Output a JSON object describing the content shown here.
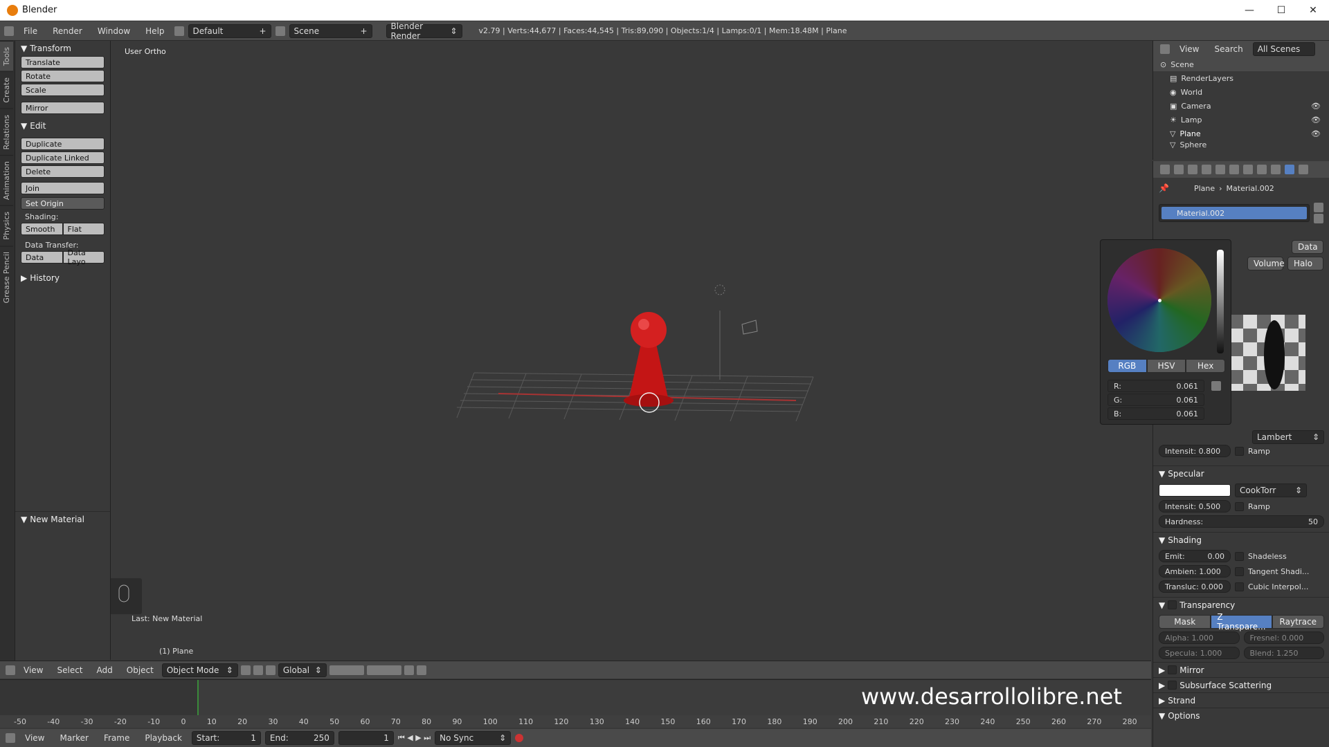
{
  "window": {
    "title": "Blender"
  },
  "infobar": {
    "menus": [
      "File",
      "Render",
      "Window",
      "Help"
    ],
    "layout": "Default",
    "scene": "Scene",
    "engine": "Blender Render",
    "stats": "v2.79 | Verts:44,677 | Faces:44,545 | Tris:89,090 | Objects:1/4 | Lamps:0/1 | Mem:18.48M | Plane"
  },
  "side_tabs": [
    "Tools",
    "Create",
    "Relations",
    "Animation",
    "Physics",
    "Grease Pencil"
  ],
  "toolshelf": {
    "transform_title": "Transform",
    "translate": "Translate",
    "rotate": "Rotate",
    "scale": "Scale",
    "mirror": "Mirror",
    "edit_title": "Edit",
    "duplicate": "Duplicate",
    "duplicate_linked": "Duplicate Linked",
    "delete": "Delete",
    "join": "Join",
    "set_origin": "Set Origin",
    "shading_label": "Shading:",
    "smooth": "Smooth",
    "flat": "Flat",
    "data_transfer_label": "Data Transfer:",
    "data": "Data",
    "data_layo": "Data Layo",
    "history_title": "History",
    "new_material_title": "New Material"
  },
  "viewport": {
    "title": "User Ortho",
    "last_op": "Last: New Material",
    "object_label": "(1) Plane"
  },
  "viewport_header": {
    "menus": [
      "View",
      "Select",
      "Add",
      "Object"
    ],
    "mode": "Object Mode",
    "orientation": "Global"
  },
  "timeline": {
    "ticks": [
      "-50",
      "-40",
      "-30",
      "-20",
      "-10",
      "0",
      "10",
      "20",
      "30",
      "40",
      "50",
      "60",
      "70",
      "80",
      "90",
      "100",
      "110",
      "120",
      "130",
      "140",
      "150",
      "160",
      "170",
      "180",
      "190",
      "200",
      "210",
      "220",
      "230",
      "240",
      "250",
      "260",
      "270",
      "280"
    ],
    "menus": [
      "View",
      "Marker",
      "Frame",
      "Playback"
    ],
    "start": "Start:",
    "start_val": "1",
    "end": "End:",
    "end_val": "250",
    "current": "1",
    "sync": "No Sync"
  },
  "outliner": {
    "view": "View",
    "search": "Search",
    "filter": "All Scenes",
    "items": [
      "Scene",
      "RenderLayers",
      "World",
      "Camera",
      "Lamp",
      "Plane",
      "Sphere"
    ]
  },
  "properties": {
    "crumb_object": "Plane",
    "crumb_material": "Material.002",
    "material_slot": "Material.002",
    "data_btn": "Data",
    "volume_btn": "Volume",
    "halo_btn": "Halo",
    "diffuse_shader": "Lambert",
    "diffuse_intensity": "Intensit: 0.800",
    "ramp": "Ramp",
    "specular_title": "Specular",
    "specular_shader": "CookTorr",
    "specular_intensity": "Intensit: 0.500",
    "hardness_label": "Hardness:",
    "hardness_val": "50",
    "shading_title": "Shading",
    "emit": "Emit:",
    "emit_val": "0.00",
    "ambient": "Ambien: 1.000",
    "transluc": "Transluc: 0.000",
    "shadeless": "Shadeless",
    "tangent": "Tangent Shadi...",
    "cubic": "Cubic Interpol...",
    "transparency_title": "Transparency",
    "mask": "Mask",
    "ztransp": "Z Transpare...",
    "raytrace": "Raytrace",
    "alpha": "Alpha: 1.000",
    "fresnel": "Fresnel: 0.000",
    "specula": "Specula: 1.000",
    "blend": "Blend: 1.250",
    "mirror_title": "Mirror",
    "sss_title": "Subsurface Scattering",
    "strand_title": "Strand",
    "options_title": "Options"
  },
  "color_picker": {
    "tab_rgb": "RGB",
    "tab_hsv": "HSV",
    "tab_hex": "Hex",
    "r_label": "R:",
    "r_val": "0.061",
    "g_label": "G:",
    "g_val": "0.061",
    "b_label": "B:",
    "b_val": "0.061"
  },
  "watermark": "www.desarrollolibre.net",
  "colors": {
    "accent": "#5680c2",
    "object_red": "#d01818"
  }
}
